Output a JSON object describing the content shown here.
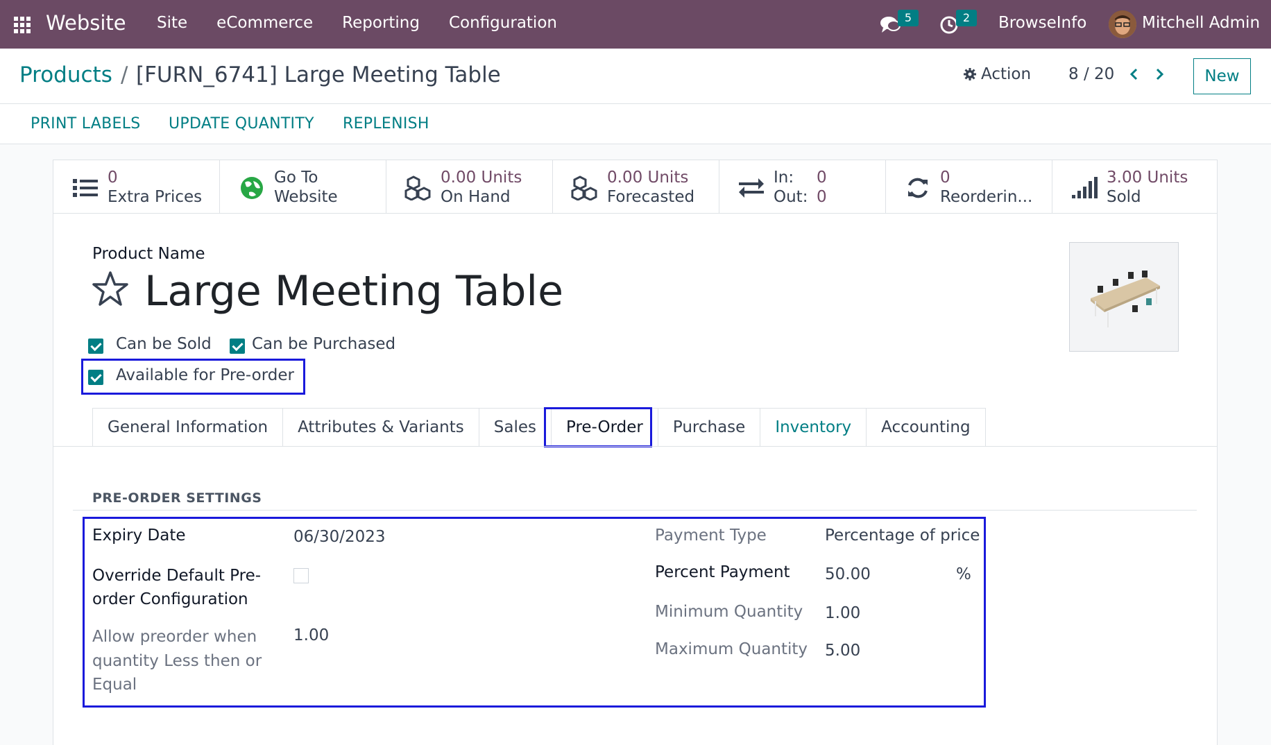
{
  "navbar": {
    "brand": "Website",
    "menu": [
      "Site",
      "eCommerce",
      "Reporting",
      "Configuration"
    ],
    "messages_count": "5",
    "activities_count": "2",
    "company": "BrowseInfo",
    "user": "Mitchell Admin"
  },
  "breadcrumb": {
    "parent": "Products",
    "separator": "/",
    "current": "[FURN_6741] Large Meeting Table"
  },
  "control": {
    "action_label": "Action",
    "pager": "8 / 20",
    "new_label": "New"
  },
  "statusbar": {
    "buttons": [
      "PRINT LABELS",
      "UPDATE QUANTITY",
      "REPLENISH"
    ]
  },
  "smart_buttons": [
    {
      "icon": "list-icon",
      "value": "0",
      "label": "Extra Prices"
    },
    {
      "icon": "globe-icon",
      "value": "Go To",
      "label": "Website"
    },
    {
      "icon": "cubes-icon",
      "value": "0.00 Units",
      "label": "On Hand"
    },
    {
      "icon": "cubes-icon",
      "value": "0.00 Units",
      "label": "Forecasted"
    },
    {
      "icon": "exchange-icon",
      "in_label": "In:",
      "in_value": "0",
      "out_label": "Out:",
      "out_value": "0"
    },
    {
      "icon": "refresh-icon",
      "value": "0",
      "label": "Reorderin..."
    },
    {
      "icon": "signal-icon",
      "value": "3.00 Units",
      "label": "Sold"
    }
  ],
  "product": {
    "name_label": "Product Name",
    "name": "Large Meeting Table",
    "can_be_sold": "Can be Sold",
    "can_be_purchased": "Can be Purchased",
    "available_preorder": "Available for Pre-order"
  },
  "tabs": [
    "General Information",
    "Attributes & Variants",
    "Sales",
    "Pre-Order",
    "Purchase",
    "Inventory",
    "Accounting"
  ],
  "preorder": {
    "section_title": "PRE-ORDER SETTINGS",
    "expiry_label": "Expiry Date",
    "expiry_value": "06/30/2023",
    "override_label_1": "Override Default Pre-",
    "override_label_2": "order Configuration",
    "allow_label_1": "Allow preorder when",
    "allow_label_2": "quantity Less then or",
    "allow_label_3": "Equal",
    "allow_value": "1.00",
    "payment_type_label": "Payment Type",
    "payment_type_value": "Percentage of price",
    "percent_label": "Percent Payment",
    "percent_value": "50.00",
    "percent_unit": "%",
    "min_qty_label": "Minimum Quantity",
    "min_qty_value": "1.00",
    "max_qty_label": "Maximum Quantity",
    "max_qty_value": "5.00"
  },
  "colors": {
    "navbar": "#6b4a64",
    "accent": "#017e84",
    "value": "#714b67",
    "highlight": "#1a1adb"
  }
}
